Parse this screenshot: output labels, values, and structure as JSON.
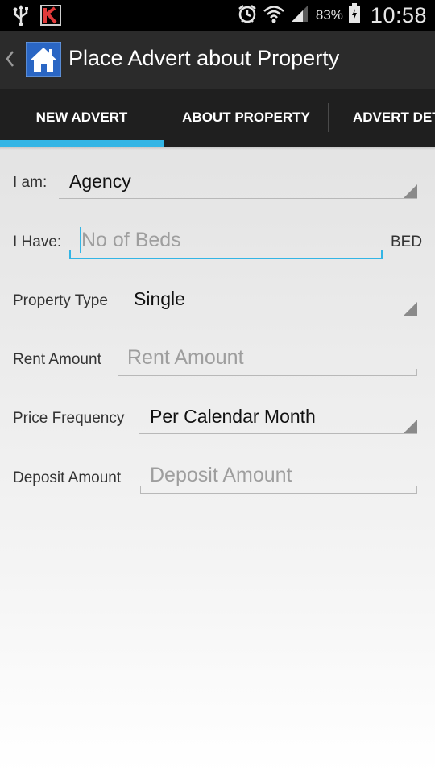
{
  "status_bar": {
    "battery_percent": "83%",
    "time": "10:58",
    "icons": [
      "usb-icon",
      "kaspersky-icon",
      "alarm-icon",
      "wifi-icon",
      "signal-icon",
      "battery-icon"
    ]
  },
  "action_bar": {
    "title": "Place Advert about Property",
    "icon": "house-icon"
  },
  "tabs": [
    {
      "label": "NEW ADVERT",
      "selected": true
    },
    {
      "label": "ABOUT PROPERTY",
      "selected": false
    },
    {
      "label": "ADVERT DET",
      "selected": false
    }
  ],
  "form": {
    "i_am": {
      "label": "I am:",
      "value": "Agency"
    },
    "i_have": {
      "label": "I Have:",
      "placeholder": "No of Beds",
      "unit": "BED"
    },
    "property_type": {
      "label": "Property Type",
      "value": "Single"
    },
    "rent_amount": {
      "label": "Rent Amount",
      "placeholder": "Rent Amount"
    },
    "price_frequency": {
      "label": "Price Frequency",
      "value": "Per Calendar Month"
    },
    "deposit_amount": {
      "label": "Deposit Amount",
      "placeholder": "Deposit Amount"
    }
  },
  "colors": {
    "accent": "#33b5e5",
    "action_bar": "#2b2b2b",
    "tab_bar": "#1f1f1f"
  }
}
